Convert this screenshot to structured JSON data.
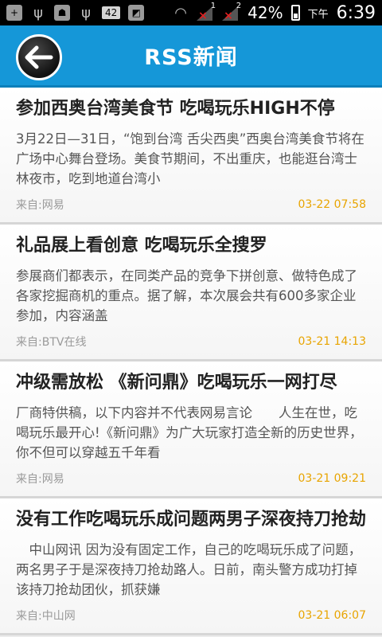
{
  "status_bar": {
    "battery_percent": "42%",
    "am_pm": "下午",
    "time": "6:39",
    "badge": "42",
    "sim1": "1",
    "sim2": "2"
  },
  "header": {
    "title": "RSS新闻"
  },
  "items": [
    {
      "title": "参加西奥台湾美食节 吃喝玩乐HIGH不停",
      "summary": "3月22日—31日，“饱到台湾 舌尖西奥”西奥台湾美食节将在广场中心舞台登场。美食节期间，不出重庆，也能逛台湾士林夜市，吃到地道台湾小",
      "source": "来自:网易",
      "date": "03-22 07:58"
    },
    {
      "title": "礼品展上看创意 吃喝玩乐全搜罗",
      "summary": "参展商们都表示，在同类产品的竞争下拼创意、做特色成了各家挖掘商机的重点。据了解，本次展会共有600多家企业参加，内容涵盖",
      "source": "来自:BTV在线",
      "date": "03-21 14:13"
    },
    {
      "title": "冲级需放松 《新问鼎》吃喝玩乐一网打尽",
      "summary": "厂商特供稿，以下内容并不代表网易言论　　人生在世，吃喝玩乐最开心!《新问鼎》为广大玩家打造全新的历史世界，你不但可以穿越五千年看",
      "source": "来自:网易",
      "date": "03-21 09:21"
    },
    {
      "title": "没有工作吃喝玩乐成问题两男子深夜持刀抢劫",
      "summary": "　中山网讯 因为没有固定工作，自己的吃喝玩乐成了问题，两名男子于是深夜持刀抢劫路人。日前，南头警方成功打掉该持刀抢劫团伙，抓获嫌",
      "source": "来自:中山网",
      "date": "03-21 06:07"
    }
  ]
}
